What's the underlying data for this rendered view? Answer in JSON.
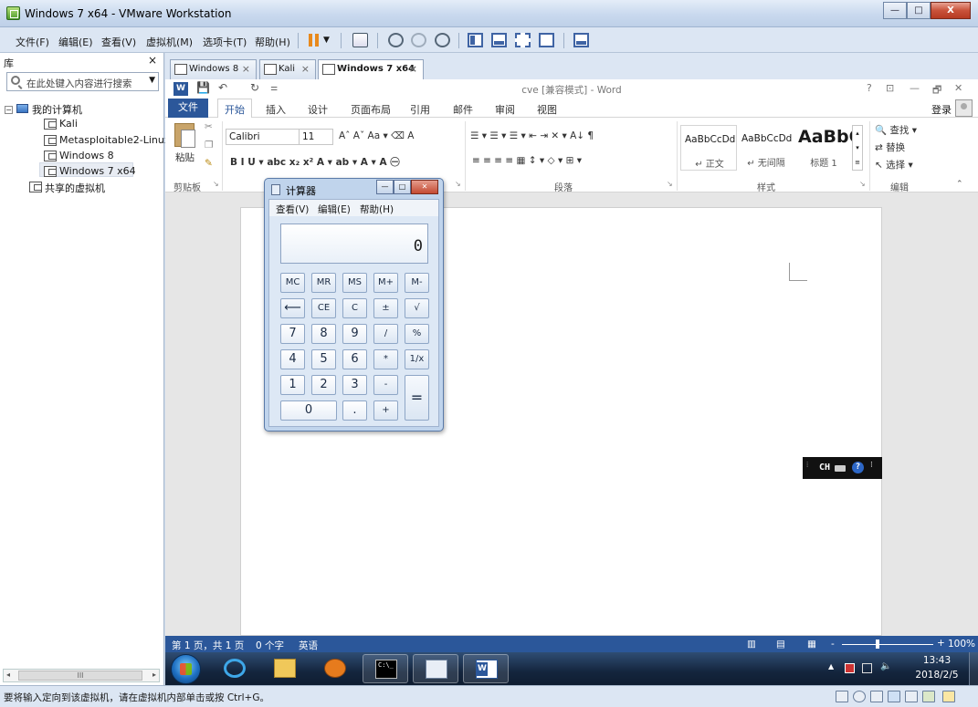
{
  "vmware": {
    "title": "Windows 7 x64 - VMware Workstation",
    "window_controls": {
      "minimize": "—",
      "maximize": "□",
      "close": "X"
    },
    "menu": [
      "文件(F)",
      "编辑(E)",
      "查看(V)",
      "虚拟机(M)",
      "选项卡(T)",
      "帮助(H)"
    ],
    "library": {
      "label": "库",
      "close": "×",
      "search_placeholder": "在此处键入内容进行搜索",
      "tree": {
        "root": "我的计算机",
        "root_expander": "⊟",
        "vms": [
          "Kali",
          "Metasploitable2-Linux",
          "Windows 8",
          "Windows 7 x64"
        ],
        "selected": "Windows 7 x64",
        "shared": "共享的虚拟机"
      },
      "scroll_thumb": "III"
    },
    "tabs": [
      {
        "label": "Windows 8",
        "active": false
      },
      {
        "label": "Kali",
        "active": false
      },
      {
        "label": "Windows 7 x64",
        "active": true
      }
    ],
    "tab_close": "×",
    "status_text": "要将输入定向到该虚拟机，请在虚拟机内部单击或按 Ctrl+G。"
  },
  "word": {
    "doc_title": "cve [兼容模式] - Word",
    "title_controls": [
      "?",
      "⊡",
      "—",
      "🗗",
      "✕"
    ],
    "ribbon_tabs": [
      "文件",
      "开始",
      "插入",
      "设计",
      "页面布局",
      "引用",
      "邮件",
      "审阅",
      "视图"
    ],
    "active_tab": "开始",
    "login": "登录",
    "clipboard": {
      "paste": "粘贴",
      "label": "剪贴板"
    },
    "font": {
      "name": "Calibri",
      "size": "11",
      "row1": "Aˆ Aˇ  Aa ▾  ⌫  A",
      "row2": "B  I  U ▾ abc x₂ x²  A ▾ ab ▾ A ▾ A ㊀"
    },
    "paragraph": {
      "row1": "☰ ▾ ☰ ▾ ☰ ▾  ⇤ ⇥  ✕ ▾  A↓  ¶",
      "row2": "≡  ≡  ≡  ≡  ▦   ↕ ▾   ◇ ▾  ⊞ ▾",
      "label": "段落"
    },
    "styles": {
      "items": [
        {
          "sample": "AaBbCcDd",
          "name": "↵ 正文"
        },
        {
          "sample": "AaBbCcDd",
          "name": "↵ 无间隔"
        },
        {
          "sample": "AaBbC",
          "name": "标题 1"
        }
      ],
      "label": "样式"
    },
    "editing": {
      "find": "查找 ▾",
      "replace": "替换",
      "select": "选择 ▾",
      "label": "编辑"
    },
    "status": {
      "page": "第 1 页，共 1 页",
      "words": "0 个字",
      "lang": "英语",
      "zoom": "100%",
      "zoom_minus": "-",
      "zoom_plus": "+"
    }
  },
  "calculator": {
    "title": "计算器",
    "menu": [
      "查看(V)",
      "编辑(E)",
      "帮助(H)"
    ],
    "display": "0",
    "keys": {
      "memory": [
        "MC",
        "MR",
        "MS",
        "M+",
        "M-"
      ],
      "row2": [
        "⟵",
        "CE",
        "C",
        "±",
        "√"
      ],
      "row3": [
        "7",
        "8",
        "9",
        "/",
        "%"
      ],
      "row4": [
        "4",
        "5",
        "6",
        "*",
        "1/x"
      ],
      "row5": [
        "1",
        "2",
        "3",
        "-"
      ],
      "row6": [
        "0",
        ".",
        "+"
      ],
      "equals": "="
    }
  },
  "ime": {
    "lang": "CH",
    "help": "?",
    "more": "⁝"
  },
  "taskbar": {
    "cmd_glyph": "C:\\_",
    "clock_time": "13:43",
    "clock_date": "2018/2/5"
  }
}
